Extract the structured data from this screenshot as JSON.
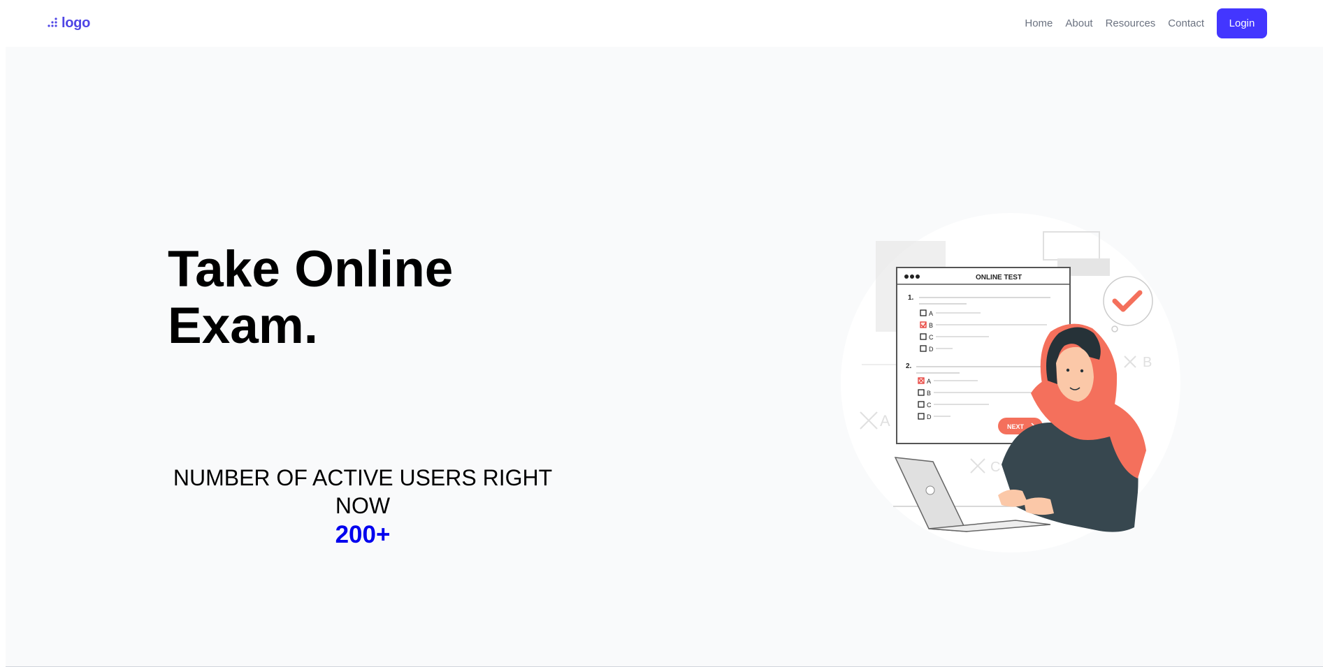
{
  "nav": {
    "logo_text": "logo",
    "links": [
      "Home",
      "About",
      "Resources",
      "Contact"
    ],
    "login_label": "Login"
  },
  "hero": {
    "title_line1": "Take Online",
    "title_line2": "Exam.",
    "stats_label": "NUMBER OF ACTIVE USERS RIGHT NOW",
    "stats_value": "200+"
  },
  "illustration": {
    "test_title": "ONLINE TEST",
    "question_numbers": [
      "1.",
      "2."
    ],
    "options": [
      "A",
      "B",
      "C",
      "D"
    ],
    "next_label": "NEXT",
    "bg_letters": [
      "A",
      "B",
      "C"
    ]
  },
  "colors": {
    "accent": "#4336ff",
    "logo": "#4f46e5",
    "stats_value": "#0000ee",
    "illustration_red": "#f4705c",
    "illustration_dark": "#37474f"
  }
}
